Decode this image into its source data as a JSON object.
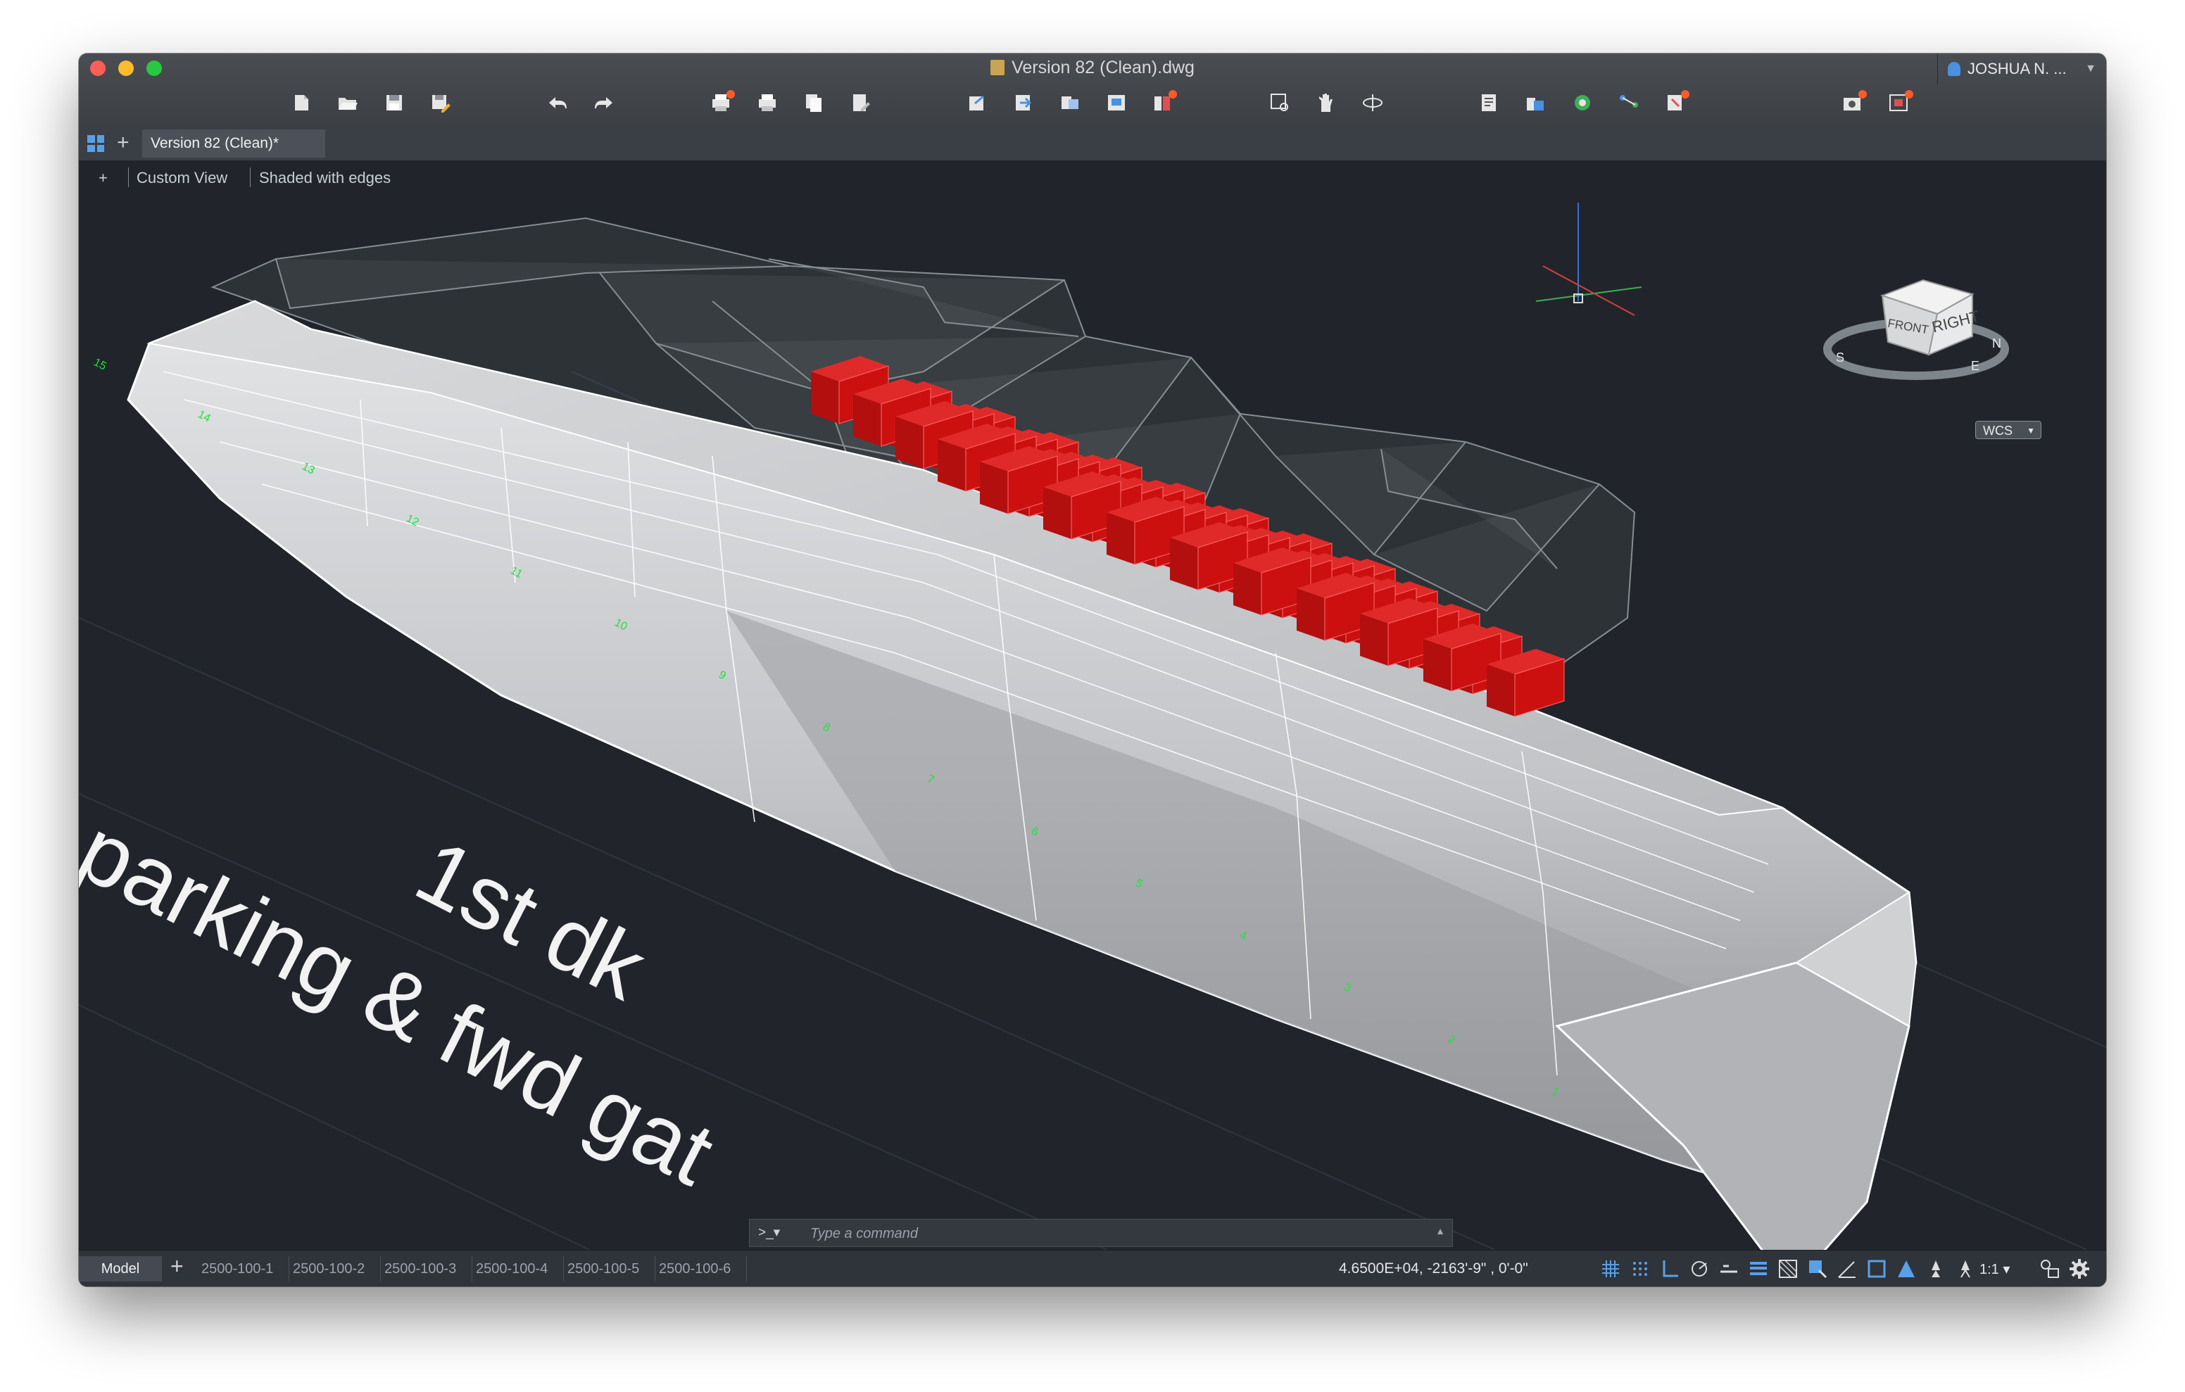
{
  "window": {
    "title": "Version 82 (Clean).dwg",
    "user": "JOSHUA N. ..."
  },
  "toolbar_icons": [
    "new-file-icon",
    "open-folder-icon",
    "save-icon",
    "save-as-icon",
    "undo-icon",
    "redo-icon",
    "plot-icon",
    "print-icon",
    "publish-icon",
    "batch-plot-icon",
    "export-icon",
    "import-icon",
    "attach-icon",
    "xref-icon",
    "layer-states-icon",
    "zoom-window-icon",
    "pan-hand-icon",
    "orbit-icon",
    "properties-icon",
    "layers-icon",
    "render-icon",
    "share-icon",
    "fields-icon",
    "camera-icon",
    "viewport-settings-icon"
  ],
  "tabs": {
    "document": "Version 82 (Clean)*"
  },
  "viewport": {
    "controls": "+",
    "view": "Custom View",
    "visual_style": "Shaded with edges",
    "ucs": "WCS",
    "viewcube": {
      "front": "FRONT",
      "right": "RIGHT",
      "compass": [
        "S",
        "E",
        "N"
      ]
    },
    "annotation": {
      "line1": "1st dk",
      "line2": "parking & fwd gat"
    },
    "grid_numbers": [
      "15",
      "14",
      "13",
      "12",
      "11",
      "10",
      "9",
      "8",
      "7",
      "6",
      "5",
      "4",
      "3",
      "2",
      "1"
    ],
    "colors": {
      "background": "#21252b",
      "hull": "#c9cbce",
      "vehicles": "#cc1010",
      "grid_labels": "#22e03c"
    }
  },
  "command_line": {
    "prompt": ">_▾",
    "placeholder": "Type a command"
  },
  "status_bar": {
    "model_tab": "Model",
    "layouts": [
      "2500-100-1",
      "2500-100-2",
      "2500-100-3",
      "2500-100-4",
      "2500-100-5",
      "2500-100-6"
    ],
    "coordinates": "4.6500E+04,   -2163'-9\"  , 0'-0\"",
    "annotation_scale": "1:1 ▾"
  }
}
